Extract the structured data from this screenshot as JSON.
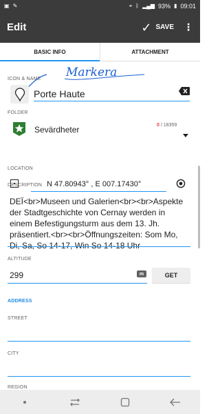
{
  "status_bar": {
    "battery": "93%",
    "time": "09:01"
  },
  "app_bar": {
    "title": "Edit",
    "save_label": "SAVE"
  },
  "tabs": [
    {
      "label": "BASIC INFO",
      "active": true
    },
    {
      "label": "ATTACHMENT",
      "active": false
    }
  ],
  "icon_name": {
    "label": "ICON & NAME",
    "handwritten_annotation": "Markera",
    "name_value": "Porte Haute"
  },
  "folder": {
    "label": "FOLDER",
    "value": "Sevärdheter",
    "count_current": "0",
    "count_total": "/ 18359",
    "icon_color": "#2e7d32"
  },
  "location": {
    "label": "LOCATION",
    "value": "N 47.80943° , E 007.17430°"
  },
  "description": {
    "label": "DESCRIPTION",
    "value": "DEÏ<br>Museen und Galerien<br><br>Aspekte der Stadtgeschichte von Cernay werden in einem Befestigungsturm aus dem 13. Jh. präsentiert.<br><br>Öffnungszeiten: Som Mo, Di, Sa, So 14-17,  Win So 14-18 Uhr"
  },
  "altitude": {
    "label": "ALTITUDE",
    "value": "299",
    "unit": "m",
    "get_label": "GET"
  },
  "address": {
    "header": "ADDRESS",
    "street_label": "STREET",
    "city_label": "CITY",
    "region_label": "REGION"
  },
  "colors": {
    "accent": "#2196f3",
    "toolbar": "#3b3b3b",
    "count_red": "#e53935"
  },
  "icons": [
    "close-backspace-icon",
    "star-folder-icon",
    "map-pin-icon",
    "locate-target-icon",
    "check-icon",
    "more-vert-icon"
  ]
}
